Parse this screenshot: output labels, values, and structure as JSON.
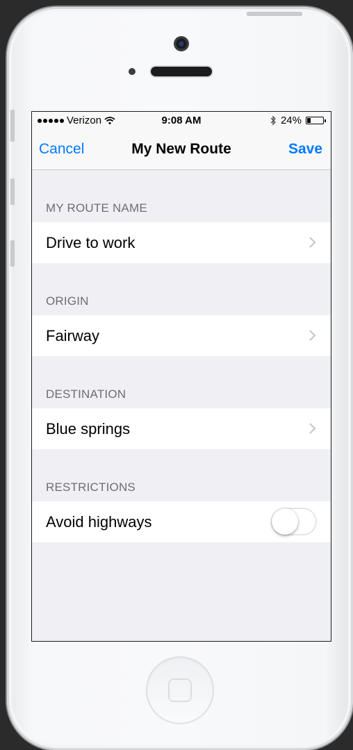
{
  "status_bar": {
    "carrier": "Verizon",
    "time": "9:08 AM",
    "battery_percent": "24%",
    "battery_level": 0.24,
    "icons": [
      "signal-dots-icon",
      "wifi-icon",
      "bluetooth-icon",
      "battery-icon"
    ]
  },
  "nav": {
    "cancel_label": "Cancel",
    "title": "My New Route",
    "save_label": "Save"
  },
  "sections": [
    {
      "header": "MY ROUTE NAME",
      "value": "Drive to work",
      "accessory": "chevron-right-icon"
    },
    {
      "header": "ORIGIN",
      "value": "Fairway",
      "accessory": "chevron-right-icon"
    },
    {
      "header": "DESTINATION",
      "value": "Blue springs",
      "accessory": "chevron-right-icon"
    },
    {
      "header": "RESTRICTIONS",
      "value": "Avoid highways",
      "accessory": "toggle",
      "toggle_on": false
    }
  ],
  "colors": {
    "accent": "#007aff",
    "grouped_background": "#efeff4",
    "header_text": "#6d6d72"
  }
}
